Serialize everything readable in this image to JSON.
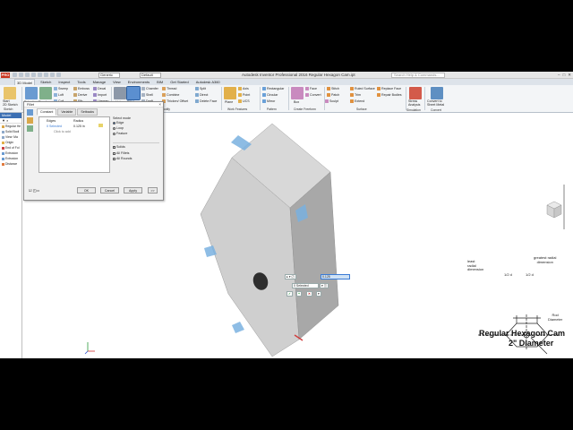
{
  "app": {
    "window_title": "Autodesk Inventor Professional 2016   Regular Hexagon Cam.ipt",
    "material_combo": "Generic",
    "appearance_combo": "Default",
    "help_search_placeholder": "Search Help & Commands...",
    "app_button": "PRO"
  },
  "tabs": [
    "3D Model",
    "Sketch",
    "Inspect",
    "Tools",
    "Manage",
    "View",
    "Environments",
    "BIM",
    "Get Started",
    "Autodesk A360"
  ],
  "ribbon": {
    "sketch_panel": {
      "start_sketch": "Start\n2D Sketch",
      "label": "Sketch"
    },
    "create_panel": {
      "extrude": "Extrude",
      "revolve": "Revolve",
      "small": [
        "Sweep",
        "Loft",
        "Coil",
        "Emboss",
        "Derive",
        "Rib",
        "Decal",
        "Import",
        "Unwrap"
      ],
      "label": "Create"
    },
    "modify_panel": {
      "hole": "Hole",
      "fillet": "Fillet",
      "small": [
        "Chamfer",
        "Shell",
        "Draft",
        "Thread",
        "Combine",
        "Thicken/ Offset",
        "Split",
        "Direct",
        "Delete Face"
      ],
      "label": "Modify"
    },
    "work_features_panel": {
      "plane": "Plane",
      "small": [
        "Axis",
        "Point",
        "UCS"
      ],
      "label": "Work Features"
    },
    "pattern_panel": {
      "small": [
        "Rectangular",
        "Circular",
        "Mirror"
      ],
      "label": "Pattern"
    },
    "freeform_panel": {
      "box": "Box",
      "small": [
        "Face",
        "Convert",
        "Sculpt"
      ],
      "label": "Create Freeform"
    },
    "surface_panel": {
      "small": [
        "Stitch",
        "Patch",
        "Trim",
        "Extend",
        "Ruled Surface",
        "Replace Face",
        "Repair Bodies"
      ],
      "label": "Surface"
    },
    "simulation_panel": {
      "stress": "Stress\nAnalysis",
      "label": "Simulation"
    },
    "convert_panel": {
      "convert": "Convert to\nSheet Metal",
      "label": "Convert"
    }
  },
  "browser": {
    "header": "Model",
    "items": [
      "Regular He",
      "Solid Bodi",
      "View: Ma",
      "Origin",
      "End of Fol",
      "Extrusion",
      "Extrusion",
      "Distance"
    ]
  },
  "fillet_dialog": {
    "title": "Fillet",
    "tabs": [
      "Constant",
      "Variable",
      "Setbacks"
    ],
    "col_edges": "Edges",
    "col_radius": "Radius",
    "row_edges": "0 Selected",
    "row_radius": "0.125 in",
    "click_to_add": "Click to add",
    "select_mode_label": "Select mode",
    "modes": [
      "Edge",
      "Loop",
      "Feature"
    ],
    "solids_label": "Solids",
    "all_fillets": "All Fillets",
    "all_rounds": "All Rounds",
    "ok": "OK",
    "cancel": "Cancel",
    "apply": "Apply",
    "more": ">>"
  },
  "mini_toolbar": {
    "radius_value": "0.125",
    "selected": "0 Selected"
  },
  "cam_drawing": {
    "least_label": "least\nradial\ndimension",
    "greatest_label": "greatest radial\ndimension",
    "half_d_1": "1/2 d",
    "half_d_2": "1/2 d",
    "rod_label": "Rod\nDiameter",
    "title_line1": "Regular Hexagon Cam",
    "title_line2": "2\" Diameter"
  },
  "colors": {
    "selected_edge": "#7ab1e0",
    "part_face": "#c8c8c8",
    "ribbon_bg": "#f3f5f7",
    "browser_head": "#3b6fb3"
  }
}
